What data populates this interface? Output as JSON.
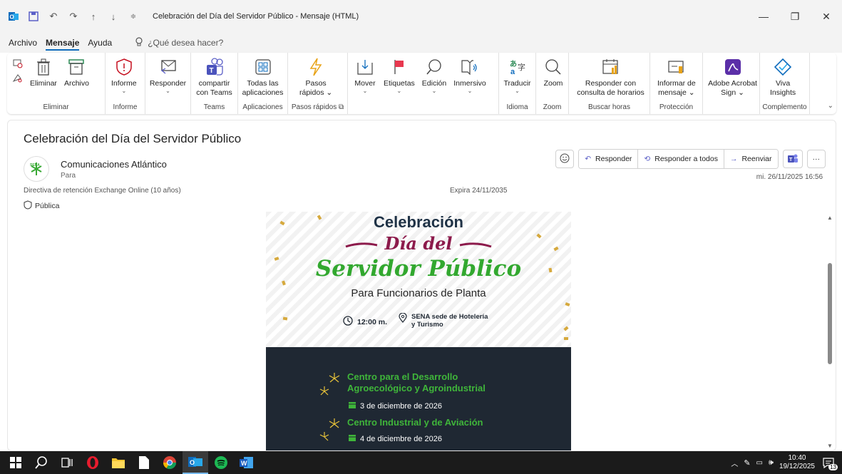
{
  "window": {
    "title": "Celebración del Día del Servidor Público  -  Mensaje (HTML)"
  },
  "menu": {
    "tabs": [
      "Archivo",
      "Mensaje",
      "Ayuda"
    ],
    "active": "Mensaje",
    "search_placeholder": "¿Qué desea hacer?"
  },
  "ribbon": {
    "groups": {
      "eliminar": {
        "name": "Eliminar",
        "delete": "Eliminar",
        "archive": "Archivo"
      },
      "informe": {
        "name": "Informe",
        "report": "Informe"
      },
      "responder": {
        "reply": "Responder"
      },
      "teams": {
        "name": "Teams",
        "share_line1": "compartir",
        "share_line2": "con Teams"
      },
      "aplicaciones": {
        "name": "Aplicaciones",
        "line1": "Todas las",
        "line2": "aplicaciones"
      },
      "pasos": {
        "name": "Pasos rápidos",
        "line1": "Pasos",
        "line2": "rápidos"
      },
      "mover": {
        "move": "Mover",
        "tags": "Etiquetas",
        "edit": "Edición",
        "immersive": "Inmersivo"
      },
      "idioma": {
        "name": "Idioma",
        "translate": "Traducir"
      },
      "zoom": {
        "name": "Zoom",
        "zoom": "Zoom"
      },
      "buscar": {
        "name": "Buscar horas",
        "line1": "Responder con",
        "line2": "consulta de horarios"
      },
      "proteccion": {
        "name": "Protección",
        "line1": "Informar de",
        "line2": "mensaje"
      },
      "adobe": {
        "line1": "Adobe Acrobat",
        "line2": "Sign"
      },
      "complemento": {
        "name": "Complemento",
        "line1": "Viva",
        "line2": "Insights"
      }
    }
  },
  "message": {
    "subject": "Celebración del Día del Servidor Público",
    "sender": "Comunicaciones Atlántico",
    "to_label": "Para",
    "retention": "Directiva de retención  Exchange Online (10 años)",
    "expira": "Expira  24/11/2035",
    "classification": "Pública",
    "date": "mi. 26/11/2025 16:56",
    "actions": {
      "reply": "Responder",
      "reply_all": "Responder a todos",
      "forward": "Reenviar"
    }
  },
  "banner": {
    "line1": "Celebración",
    "line2": "Día del",
    "line3": "Servidor Público",
    "line4": "Para Funcionarios de Planta",
    "time": "12:00 m.",
    "place_line1": "SENA sede de Hotelería",
    "place_line2": "y Turismo",
    "centers": [
      {
        "title_line1": "Centro para el Desarrollo",
        "title_line2": "Agroecológico y Agroindustrial",
        "date": "3 de diciembre de 2026"
      },
      {
        "title_line1": "Centro Industrial y de Aviación",
        "title_line2": "",
        "date": "4 de diciembre de 2026"
      }
    ]
  },
  "taskbar": {
    "time": "10:40",
    "date": "19/12/2025",
    "notifications": "13"
  },
  "colors": {
    "accent": "#0f6cbd",
    "banner_dark": "#1f2833",
    "banner_green": "#32a82f",
    "banner_magenta": "#8c1a4b"
  }
}
